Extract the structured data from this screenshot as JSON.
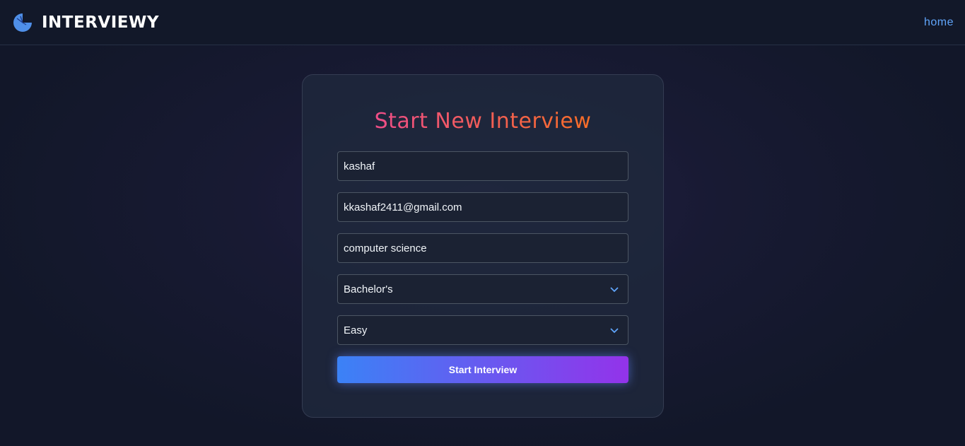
{
  "nav": {
    "brand": "INTERVIEWY",
    "home_link": "home"
  },
  "form": {
    "title": "Start New Interview",
    "name": "kashaf",
    "email": "kkashaf2411@gmail.com",
    "field_of_study": "computer science",
    "degree": "Bachelor's",
    "difficulty": "Easy",
    "submit": "Start Interview"
  }
}
